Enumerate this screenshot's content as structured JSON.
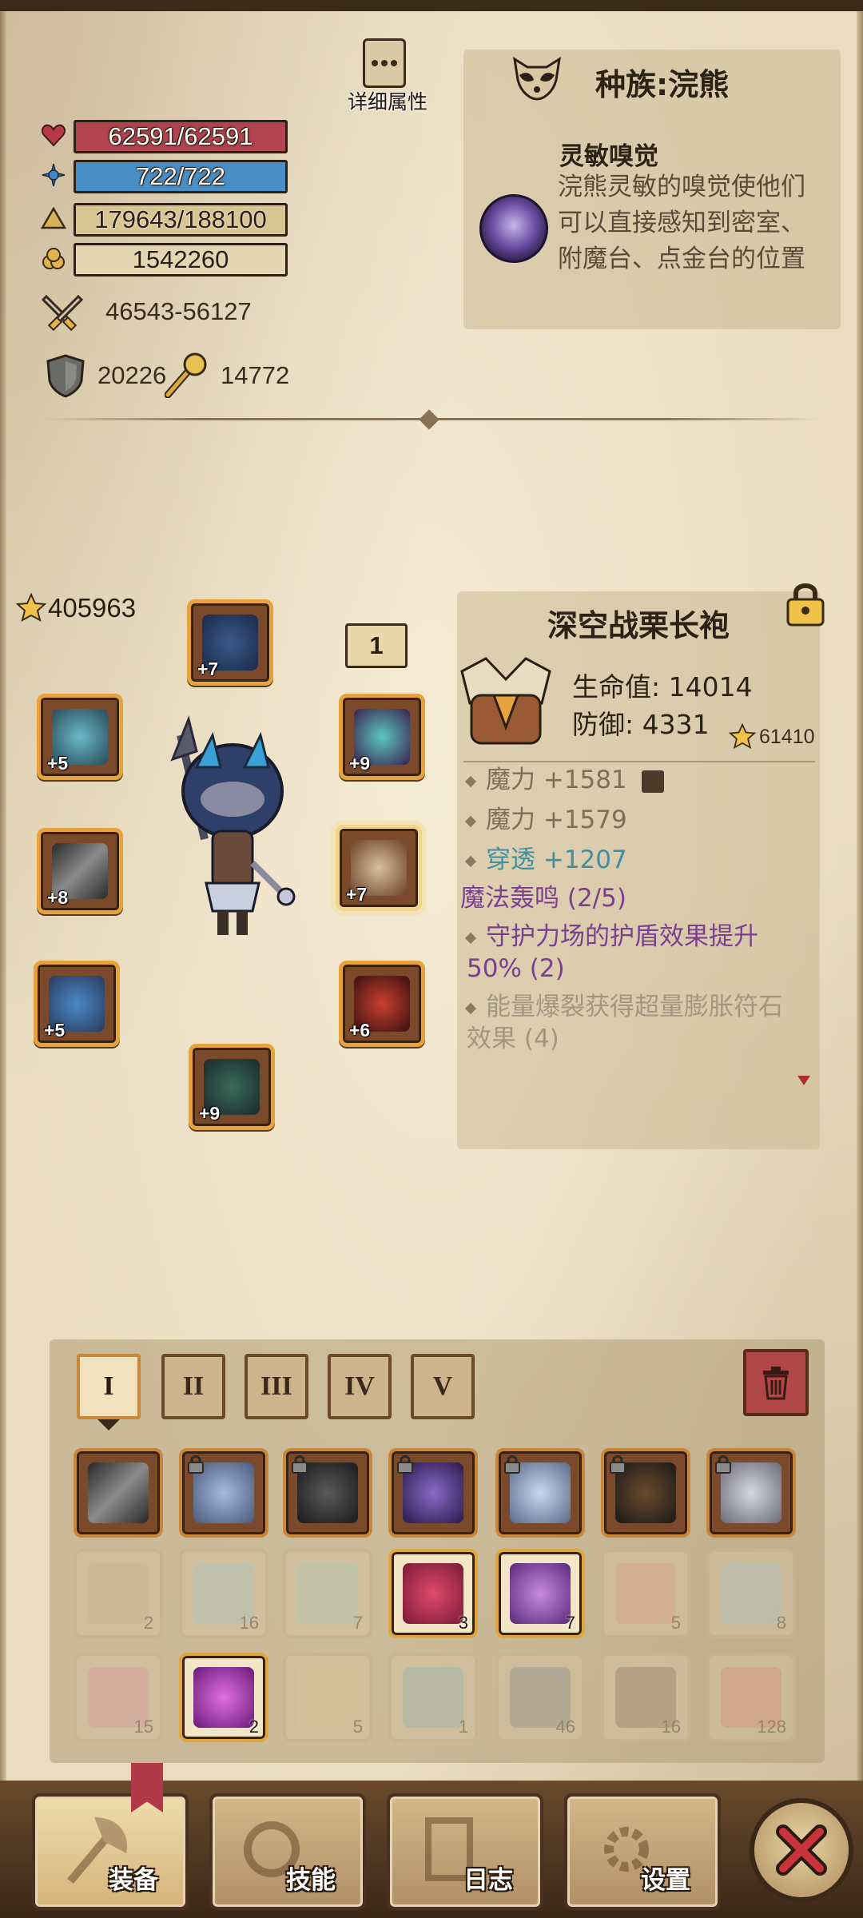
{
  "stats": {
    "hp": "62591/62591",
    "mp": "722/722",
    "exp": "179643/188100",
    "gold": "1542260",
    "attack": "46543-56127",
    "defense": "20226",
    "magic_resist": "14772"
  },
  "detail_button": {
    "label": "详细属性"
  },
  "race": {
    "title": "种族:浣熊",
    "trait_name": "灵敏嗅觉",
    "trait_desc": "浣熊灵敏的嗅觉使他们可以直接感知到密室、附魔台、点金台的位置"
  },
  "equipment": {
    "power": "405963",
    "loadout_number": "1",
    "slots": [
      {
        "name": "helmet",
        "plus": "+7"
      },
      {
        "name": "amulet",
        "plus": "+5"
      },
      {
        "name": "shoulder",
        "plus": "+9"
      },
      {
        "name": "weapon",
        "plus": "+8"
      },
      {
        "name": "armor",
        "plus": "+7"
      },
      {
        "name": "gloves",
        "plus": "+5"
      },
      {
        "name": "belt",
        "plus": "+6"
      },
      {
        "name": "boots",
        "plus": "+9"
      }
    ]
  },
  "item": {
    "title": "深空战栗长袍",
    "hp_stat": "生命值: 14014",
    "def_stat": "防御: 4331",
    "power": "61410",
    "affixes": [
      {
        "text": "魔力 +1581",
        "style": "gray"
      },
      {
        "text": "魔力 +1579",
        "style": "gray"
      },
      {
        "text": "穿透 +1207",
        "style": "teal"
      }
    ],
    "set_name": "魔法轰鸣 (2/5)",
    "set_bonus_1": "守护力场的护盾效果提升50% (2)",
    "set_bonus_2": "能量爆裂获得超量膨胀符石效果 (4)"
  },
  "inventory": {
    "tabs": [
      "I",
      "II",
      "III",
      "IV",
      "V"
    ],
    "active_tab": "I",
    "row1_counts": [
      "",
      "",
      "",
      "",
      "",
      "",
      ""
    ],
    "row2_counts": [
      "2",
      "16",
      "7",
      "3",
      "7",
      "5",
      "8"
    ],
    "row3_counts": [
      "15",
      "2",
      "5",
      "1",
      "46",
      "16",
      "128"
    ]
  },
  "nav": {
    "equip": "装备",
    "skills": "技能",
    "log": "日志",
    "settings": "设置"
  },
  "colors": {
    "hp_bar": "#b04450",
    "mp_bar": "#4a8ec6",
    "exp_bar": "#d7c592",
    "slot_border": "#e6a23c",
    "set_purple": "#7b3f8f",
    "pierce_teal": "#3f8fa0"
  }
}
